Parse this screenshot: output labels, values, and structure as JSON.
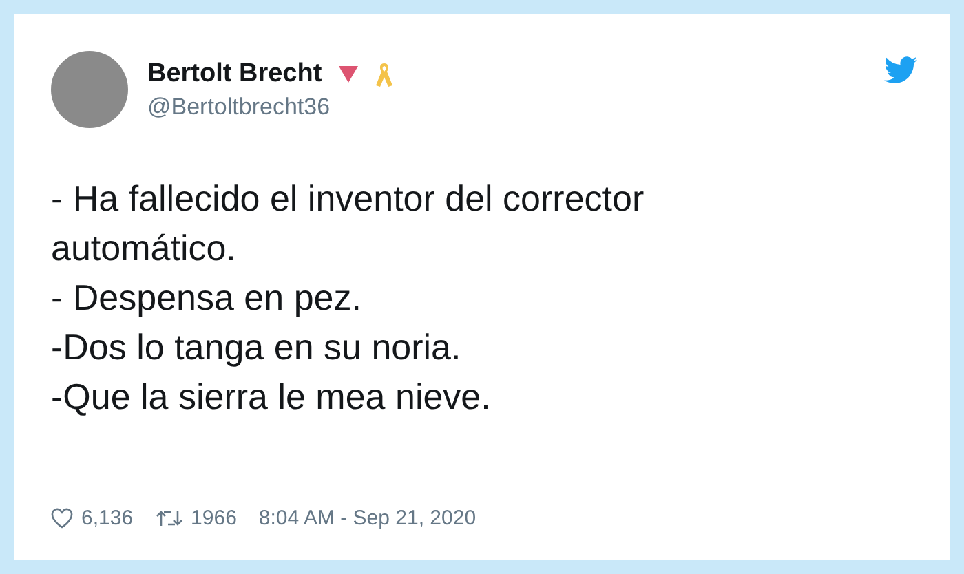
{
  "author": {
    "name": "Bertolt Brecht",
    "handle": "@Bertoltbrecht36"
  },
  "tweet": {
    "lines": [
      "- Ha fallecido el inventor del corrector automático.",
      "- Despensa en pez.",
      "-Dos lo tanga en su noria.",
      "-Que la sierra le mea nieve."
    ]
  },
  "footer": {
    "likes": "6,136",
    "retweets": "1966",
    "timestamp": "8:04 AM - Sep 21, 2020"
  }
}
